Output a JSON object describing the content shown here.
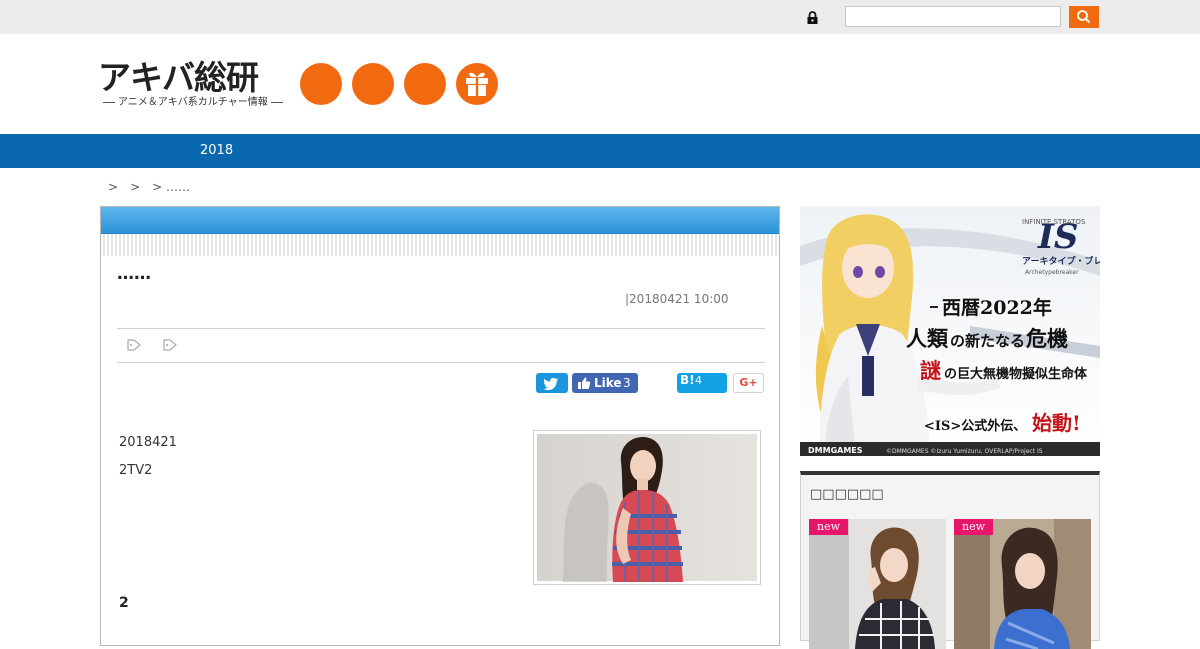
{
  "topbar": {
    "search_placeholder": "",
    "search_value": ""
  },
  "header": {
    "logo_text": "アキバ総研",
    "logo_tagline": "アニメ＆アキバ系カルチャー情報",
    "icons": [
      "orange-circle",
      "orange-circle",
      "orange-circle",
      "gift-icon"
    ]
  },
  "nav": {
    "items": [
      "2018"
    ]
  },
  "breadcrumb": {
    "separators": [
      ">",
      ">",
      ">"
    ],
    "current": "……"
  },
  "article": {
    "title": "……",
    "date": "|20180421 10:00",
    "share": {
      "facebook_label": "Like",
      "facebook_count": "3",
      "hatena_label": "B!",
      "hatena_count": "4",
      "gplus_label": "G+"
    },
    "paragraphs": [
      "2018421",
      "2TV2"
    ],
    "subheading": "2"
  },
  "ad": {
    "logo": "IS",
    "logo_sub": "INFINITE STRATOS",
    "product": "アーキタイプ・ブレイカー",
    "product_en": "Archetypebreaker",
    "line1": "西暦2022年",
    "line2a": "人類",
    "line2b": "の新たなる",
    "line2c": "危機",
    "line3a": "謎",
    "line3b": "の巨大無機物擬似生命体",
    "line4a": "<IS>公式外伝、",
    "line4b": "始動!",
    "brand": "DMMGAMES",
    "copyright": "©DMMGAMES   ©Izuru Yumizuru, OVERLAP/Project IS"
  },
  "sidebar": {
    "title": "□□□□□□",
    "cards": [
      {
        "badge": "new"
      },
      {
        "badge": "new"
      }
    ]
  },
  "colors": {
    "accent": "#f26a10",
    "nav_blue": "#0a68b0",
    "article_head": "#2b93d8",
    "new_badge": "#e6166a"
  }
}
